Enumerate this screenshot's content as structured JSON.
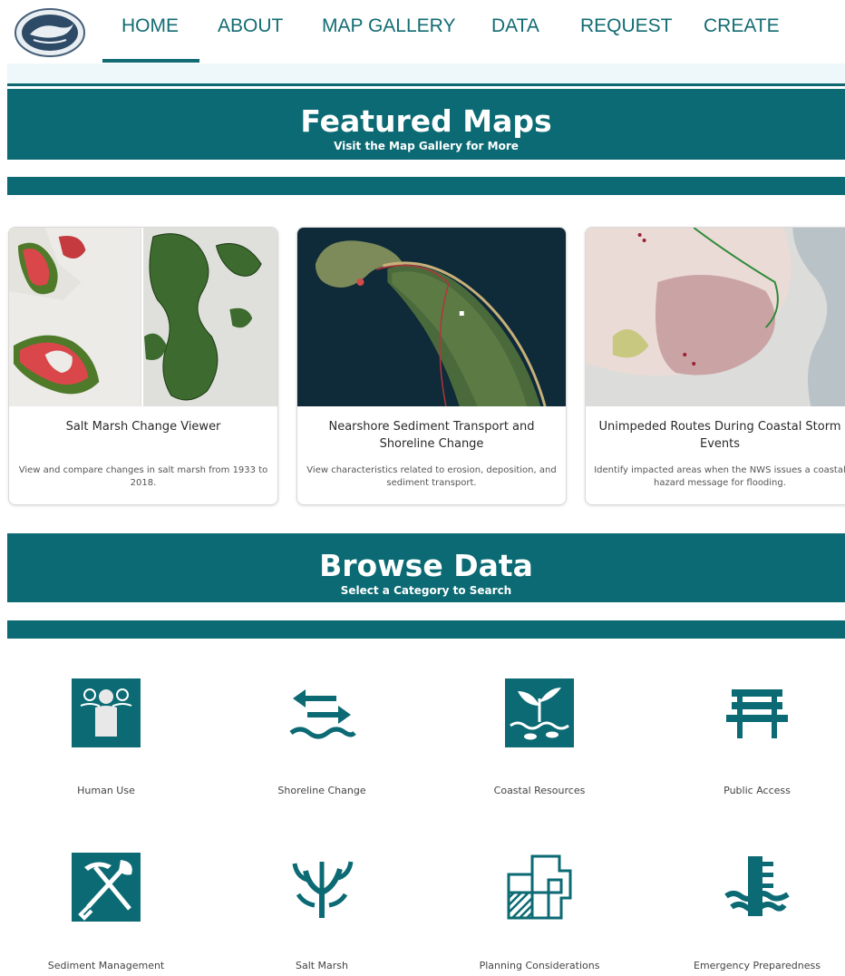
{
  "nav": {
    "items": [
      {
        "label": "HOME"
      },
      {
        "label": "ABOUT"
      },
      {
        "label": "MAP GALLERY"
      },
      {
        "label": "DATA"
      },
      {
        "label": "REQUEST"
      },
      {
        "label": "CREATE"
      }
    ],
    "active": "HOME"
  },
  "featured": {
    "title": "Featured Maps",
    "subtitle": "Visit the Map Gallery for More"
  },
  "cards": [
    {
      "title": "Salt Marsh Change Viewer",
      "description": "View and compare changes in salt marsh from 1933 to 2018."
    },
    {
      "title": "Nearshore Sediment Transport and Shoreline Change",
      "description": "View characteristics related to erosion, deposition, and sediment transport."
    },
    {
      "title": "Unimpeded Routes During Coastal Storm Events",
      "description": "Identify impacted areas when the NWS issues a coastal hazard message for flooding."
    }
  ],
  "browse": {
    "title": "Browse Data",
    "subtitle": "Select a Category to Search"
  },
  "categories": [
    {
      "label": "Human Use",
      "icon": "people-icon"
    },
    {
      "label": "Shoreline Change",
      "icon": "shoreline-arrows-icon"
    },
    {
      "label": "Coastal Resources",
      "icon": "plant-fish-icon"
    },
    {
      "label": "Public Access",
      "icon": "bench-icon"
    },
    {
      "label": "Sediment Management",
      "icon": "pick-shovel-icon"
    },
    {
      "label": "Salt Marsh",
      "icon": "marsh-grass-icon"
    },
    {
      "label": "Planning Considerations",
      "icon": "parcel-map-icon"
    },
    {
      "label": "Emergency Preparedness",
      "icon": "flood-gauge-icon"
    }
  ],
  "colors": {
    "brand": "#0b6a73",
    "nav_text": "#136c73"
  }
}
